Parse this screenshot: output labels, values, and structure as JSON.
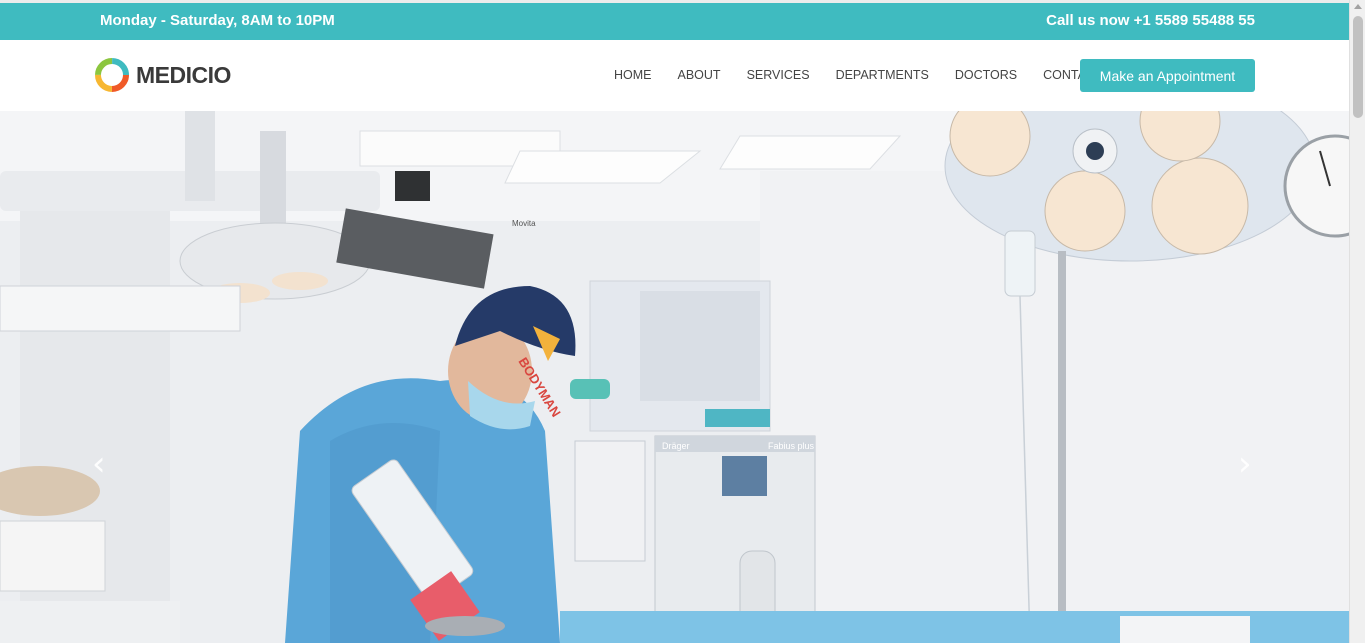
{
  "topbar": {
    "hours": "Monday - Saturday, 8AM to 10PM",
    "phone": "Call us now +1 5589 55488 55"
  },
  "header": {
    "logo_text": "MEDICIO",
    "nav": [
      {
        "label": "HOME"
      },
      {
        "label": "ABOUT"
      },
      {
        "label": "SERVICES"
      },
      {
        "label": "DEPARTMENTS"
      },
      {
        "label": "DOCTORS"
      },
      {
        "label": "CONTACT"
      }
    ],
    "cta_label": "Make an Appointment"
  },
  "hero": {
    "cap_text": "BODYMAN",
    "monitor_brand": "Dräger",
    "monitor_model": "Fabius plus",
    "arm_label": "Movita"
  },
  "colors": {
    "accent": "#3fbbc0",
    "scrub": "#5aa6d8"
  },
  "icons": {
    "prev": "chevron-left-icon",
    "next": "chevron-right-icon"
  }
}
